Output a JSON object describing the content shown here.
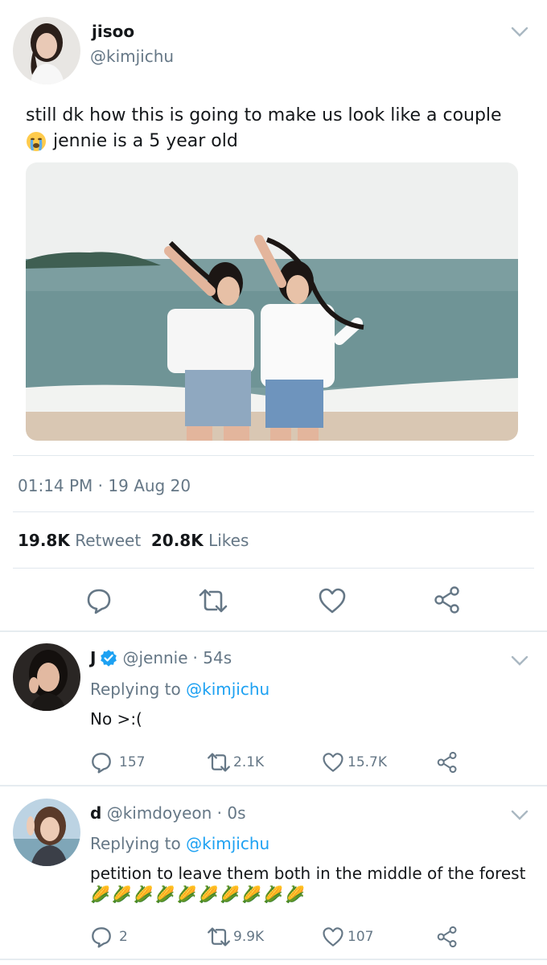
{
  "main_tweet": {
    "name": "jisoo",
    "handle": "@kimjichu",
    "text_line1": "still dk how this is going to make us look like a couple",
    "text_line2": "jennie is a 5 year old",
    "timestamp": "01:14 PM · 19 Aug 20",
    "retweets_count": "19.8K",
    "retweets_label": "Retweet",
    "likes_count": "20.8K",
    "likes_label": "Likes"
  },
  "replies": [
    {
      "name": "J",
      "handle": "@jennie",
      "time": "· 54s",
      "replying_prefix": "Replying to",
      "replying_to": "@kimjichu",
      "text": "No >:(",
      "reply_count": "157",
      "retweet_count": "2.1K",
      "like_count": "15.7K"
    },
    {
      "name": "d",
      "handle": "@kimdoyeon",
      "time": "· 0s",
      "replying_prefix": "Replying to",
      "replying_to": "@kimjichu",
      "text": "petition to leave them both in the middle of the forest",
      "emoji_line": "🌽🌽🌽🌽🌽🌽🌽🌽🌽🌽",
      "reply_count": "2",
      "retweet_count": "9.9K",
      "like_count": "107"
    }
  ],
  "colors": {
    "text": "#14171a",
    "secondary": "#657786",
    "link": "#1da1f2",
    "verified": "#1da1f2",
    "divider": "#e1e8ed"
  }
}
